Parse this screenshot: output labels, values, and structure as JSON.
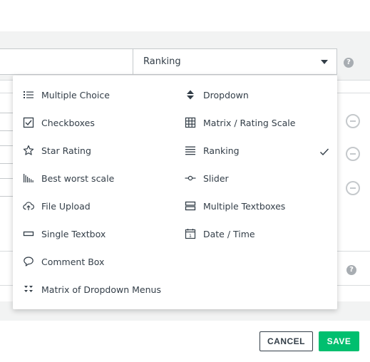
{
  "question_type_select": {
    "value": "Ranking"
  },
  "help_icon_glyph": "?",
  "menu": {
    "left_column": [
      {
        "label": "Multiple Choice",
        "icon": "list-icon"
      },
      {
        "label": "Checkboxes",
        "icon": "checkbox-icon"
      },
      {
        "label": "Star Rating",
        "icon": "star-icon"
      },
      {
        "label": "Best worst scale",
        "icon": "best-worst-icon"
      },
      {
        "label": "File Upload",
        "icon": "cloud-upload-icon"
      },
      {
        "label": "Single Textbox",
        "icon": "textbox-icon"
      },
      {
        "label": "Comment Box",
        "icon": "speech-bubble-icon"
      },
      {
        "label": "Matrix of Dropdown Menus",
        "icon": "matrix-dropdown-icon"
      }
    ],
    "right_column": [
      {
        "label": "Dropdown",
        "icon": "up-down-arrows-icon"
      },
      {
        "label": "Matrix / Rating Scale",
        "icon": "grid-icon"
      },
      {
        "label": "Ranking",
        "icon": "lines-icon",
        "selected": true
      },
      {
        "label": "Slider",
        "icon": "slider-icon"
      },
      {
        "label": "Multiple Textboxes",
        "icon": "multi-textbox-icon"
      },
      {
        "label": "Date / Time",
        "icon": "calendar-icon"
      }
    ]
  },
  "footer": {
    "cancel_label": "CANCEL",
    "save_label": "SAVE"
  },
  "colors": {
    "accent_green": "#00bf6f",
    "text": "#333e48"
  }
}
